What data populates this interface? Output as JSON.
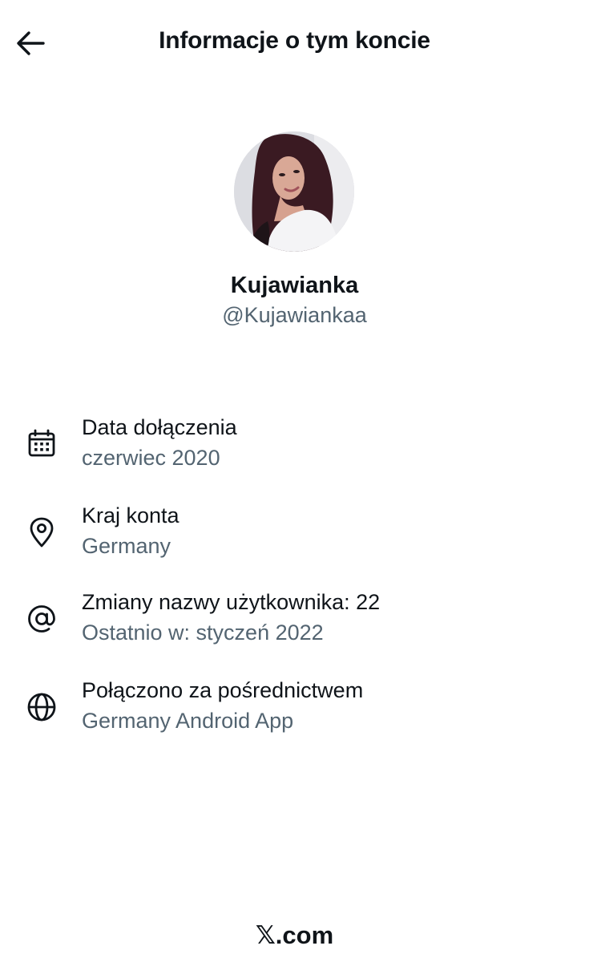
{
  "header": {
    "title": "Informacje o tym koncie",
    "back_icon": "arrow-left-icon"
  },
  "profile": {
    "name": "Kujawianka",
    "handle": "@Kujawiankaa",
    "avatar": "profile-photo"
  },
  "info": [
    {
      "icon": "calendar-icon",
      "label": "Data dołączenia",
      "value": "czerwiec 2020"
    },
    {
      "icon": "location-pin-icon",
      "label": "Kraj konta",
      "value": "Germany"
    },
    {
      "icon": "at-sign-icon",
      "label": "Zmiany nazwy użytkownika: 22",
      "value": "Ostatnio w: styczeń 2022"
    },
    {
      "icon": "globe-icon",
      "label": "Połączono za pośrednictwem",
      "value": "Germany Android App"
    }
  ],
  "footer": {
    "brand": "𝕏.com"
  },
  "colors": {
    "text_primary": "#0f1419",
    "text_secondary": "#536471",
    "background": "#ffffff"
  }
}
